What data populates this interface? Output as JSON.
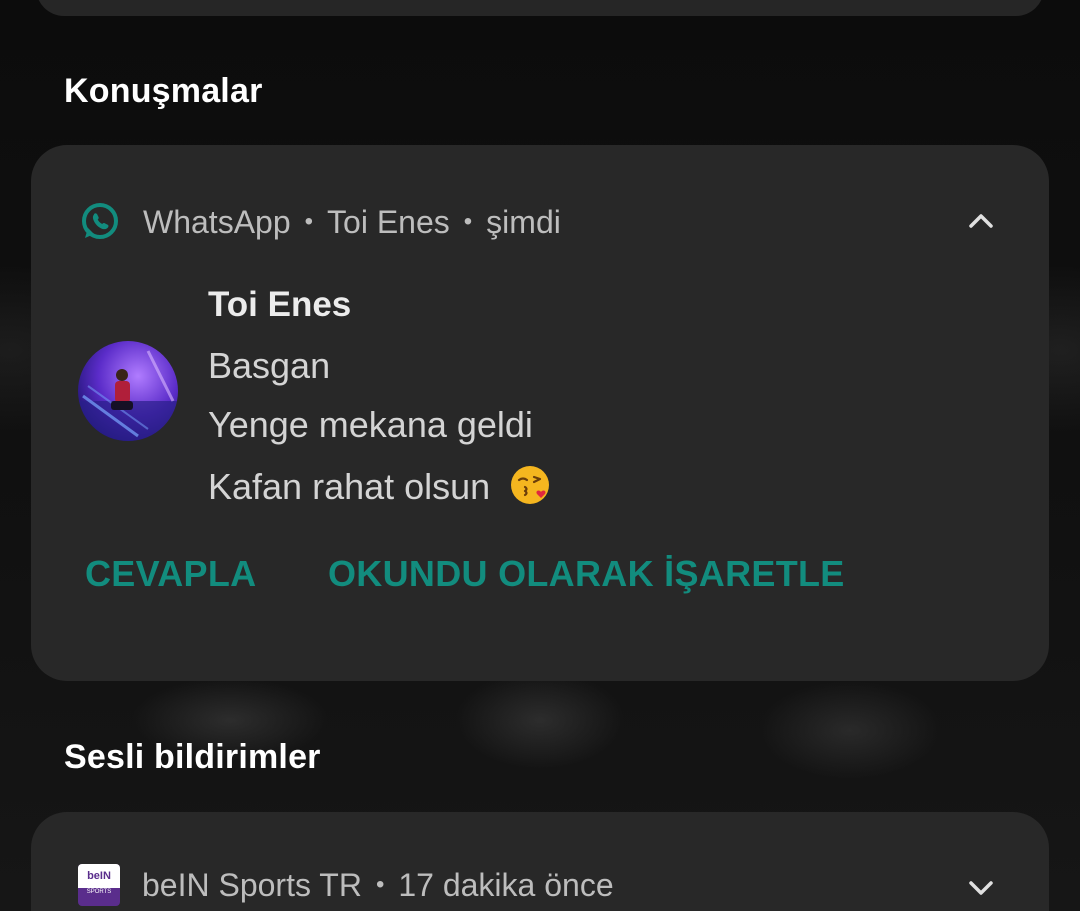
{
  "sections": {
    "conversations_title": "Konuşmalar",
    "alerting_title": "Sesli bildirimler"
  },
  "whatsapp_notification": {
    "app_name": "WhatsApp",
    "conversation": "Toi Enes",
    "time": "şimdi",
    "expand_icon": "chevron-up-icon",
    "sender": "Toi Enes",
    "messages": [
      "Basgan",
      "Yenge mekana geldi",
      "Kafan rahat olsun"
    ],
    "emoji": "face-blowing-a-kiss",
    "actions": {
      "reply": "CEVAPLA",
      "mark_read": "OKUNDU OLARAK İŞARETLE"
    },
    "accent_color": "#128c7e"
  },
  "bein_notification": {
    "app_name": "beIN Sports TR",
    "time": "17 dakika önce",
    "expand_icon": "chevron-down-icon",
    "icon_text_top": "beIN",
    "icon_text_bottom": "SPORTS"
  },
  "separator": "•"
}
